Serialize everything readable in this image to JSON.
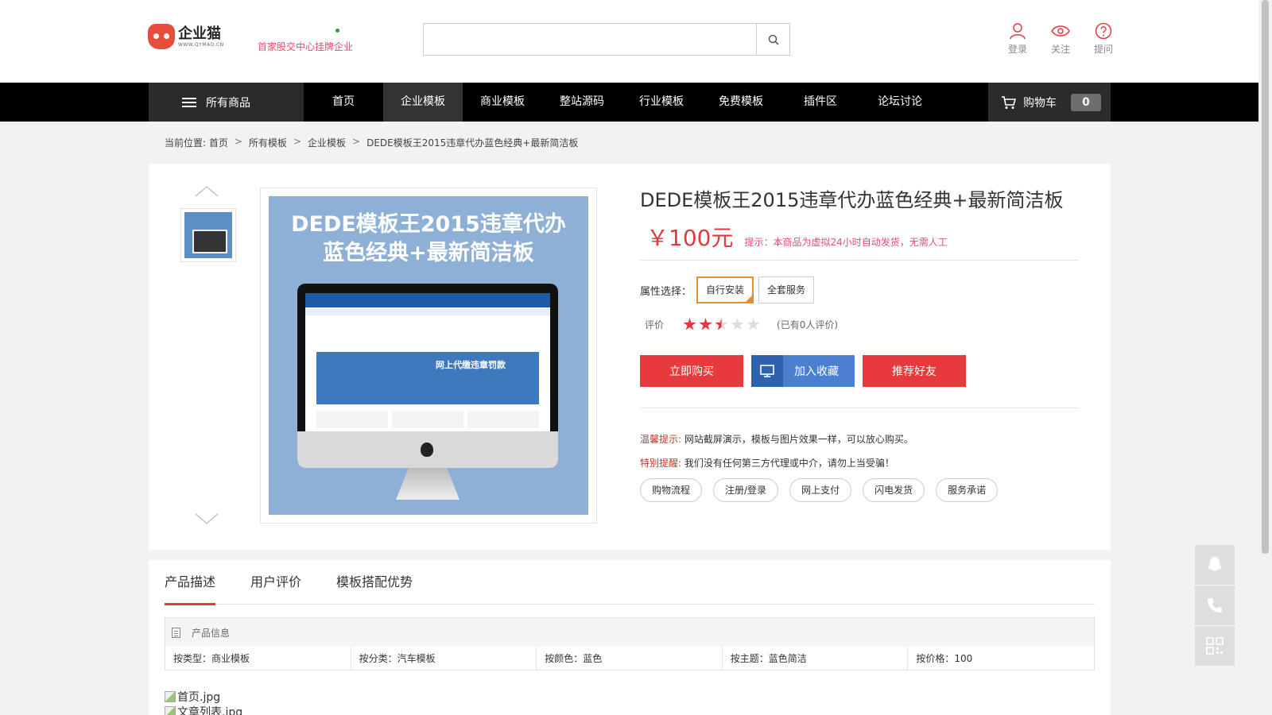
{
  "header": {
    "logo_name": "企业猫",
    "logo_url": "WWW.QYMAO.CN",
    "slogan": "首家股交中心挂牌企业",
    "search_placeholder": "",
    "links": [
      {
        "label": "登录",
        "icon": "user-icon"
      },
      {
        "label": "关注",
        "icon": "eye-icon"
      },
      {
        "label": "提问",
        "icon": "question-icon"
      }
    ]
  },
  "nav": {
    "all_goods": "所有商品",
    "items": [
      "首页",
      "企业模板",
      "商业模板",
      "整站源码",
      "行业模板",
      "免费模板",
      "插件区",
      "论坛讨论"
    ],
    "active_index": 1,
    "cart_label": "购物车",
    "cart_count": "0"
  },
  "breadcrumb": {
    "prefix": "当前位置: 首页",
    "items": [
      "所有模板",
      "企业模板",
      "DEDE模板王2015违章代办蓝色经典+最新简洁板"
    ]
  },
  "product": {
    "image_title_line1": "DEDE模板王2015违章代办",
    "image_title_line2": "蓝色经典+最新简洁板",
    "image_banner_text": "网上代缴违章罚款",
    "title": "DEDE模板王2015违章代办蓝色经典+最新简洁板",
    "price": "￥100元",
    "price_tip": "提示：本商品为虚拟24小时自动发货，无需人工",
    "attr_label": "属性选择：",
    "attr_options": [
      "自行安装",
      "全套服务"
    ],
    "attr_selected": 0,
    "rating_label": "评价",
    "rating_value": 2.5,
    "rating_max": 5,
    "rating_count": "(已有0人评价)",
    "buttons": {
      "buy": "立即购买",
      "favorite": "加入收藏",
      "recommend": "推荐好友"
    },
    "tip1_label": "温馨提示:",
    "tip1_text": "网站截屏演示，模板与图片效果一样，可以放心购买。",
    "tip2_label": "特别提醒:",
    "tip2_text": "我们没有任何第三方代理或中介，请勿上当受骗！",
    "services": [
      "购物流程",
      "注册/登录",
      "网上支付",
      "闪电发货",
      "服务承诺"
    ]
  },
  "description": {
    "tabs": [
      "产品描述",
      "用户评价",
      "模板搭配优势"
    ],
    "active_tab": 0,
    "info_title": "产品信息",
    "info_cells": [
      "按类型：商业模板",
      "按分类：汽车模板",
      "按颜色：蓝色",
      "按主题：蓝色简洁",
      "按价格：100"
    ],
    "broken_images": [
      "首页.jpg",
      "文章列表.jpg"
    ]
  },
  "colors": {
    "accent_red": "#e4393c",
    "favorite_blue": "#4a80cf",
    "nav_bg": "#000000"
  }
}
